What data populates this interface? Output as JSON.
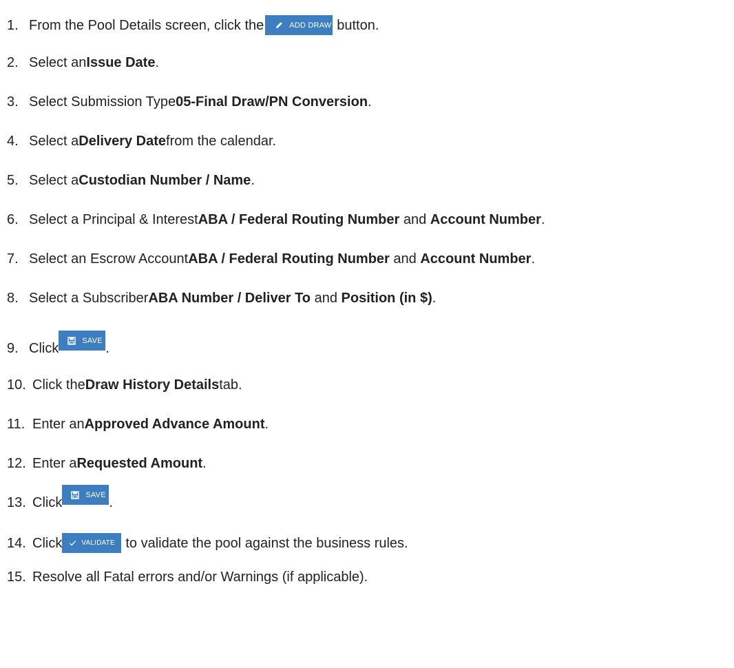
{
  "steps": [
    {
      "num": "1.",
      "t1": "From the Pool Details screen, click the ",
      "button_label": "ADD DRAW",
      "button_icon": "pencil-icon",
      "t2": " button."
    },
    {
      "num": "2.",
      "t1": "Select an ",
      "b1": "Issue Date",
      "t2": "."
    },
    {
      "num": "3.",
      "t1": "Select Submission Type ",
      "b1": "05-Final Draw/PN Conversion",
      "t2": "."
    },
    {
      "num": "4.",
      "t1": "Select a ",
      "b1": "Delivery Date",
      "t2": " from the calendar."
    },
    {
      "num": "5.",
      "t1": "Select a ",
      "b1": "Custodian Number / Name",
      "t2": "."
    },
    {
      "num": "6.",
      "t1": "Select a Principal & Interest ",
      "b1": "ABA / Federal Routing Number",
      "t2": " and ",
      "b2": "Account Number",
      "t3": "."
    },
    {
      "num": "7.",
      "t1": "Select an Escrow Account ",
      "b1": "ABA / Federal Routing Number",
      "t2": " and ",
      "b2": "Account Number",
      "t3": "."
    },
    {
      "num": "8.",
      "t1": "Select a Subscriber ",
      "b1": "ABA Number / Deliver To",
      "t2": " and ",
      "b2": "Position (in $)",
      "t3": "."
    },
    {
      "num": "9.",
      "t1": "Click ",
      "button_label": "SAVE",
      "button_icon": "save-icon",
      "t2": "."
    },
    {
      "num": "10.",
      "t1": "Click the ",
      "b1": "Draw History Details",
      "t2": " tab."
    },
    {
      "num": "11.",
      "t1": "Enter an ",
      "b1": "Approved Advance Amount",
      "t2": "."
    },
    {
      "num": "12.",
      "t1": "Enter a ",
      "b1": "Requested Amount",
      "t2": "."
    },
    {
      "num": "13.",
      "t1": "Click ",
      "button_label": "SAVE",
      "button_icon": "save-icon",
      "t2": "."
    },
    {
      "num": "14.",
      "t1": "Click ",
      "button_label": "VALIDATE",
      "button_icon": "check-icon",
      "t2": " to validate the pool against the business rules."
    },
    {
      "num": "15.",
      "t1": "Resolve all Fatal errors and/or Warnings (if applicable)."
    }
  ],
  "colors": {
    "button_bg": "#3d7ec0",
    "button_text": "#ffffff",
    "text": "#222222"
  }
}
